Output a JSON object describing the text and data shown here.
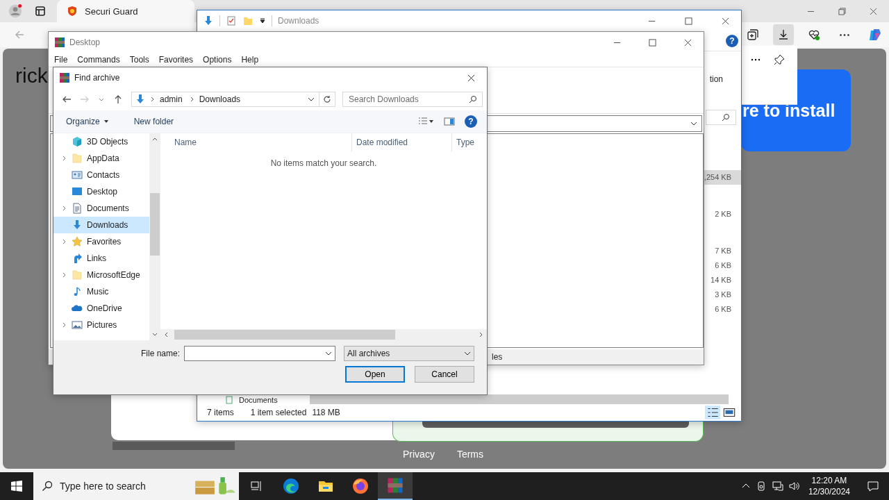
{
  "browser": {
    "tab_title": "Securi Guard",
    "toolbar_buttons": [
      {
        "selected": false
      },
      {
        "selected": true
      },
      {
        "selected": false
      },
      {
        "selected": false
      },
      {
        "selected": false
      }
    ],
    "page": {
      "heading": "rick",
      "banner": "re to install",
      "footer_links": [
        "Privacy",
        "Terms"
      ]
    }
  },
  "explorer": {
    "title": "Downloads",
    "ribbon_text": "tion",
    "sizes": [
      {
        "text": ",254 KB",
        "selected": true
      },
      {
        "text": "2 KB",
        "selected": false
      },
      {
        "text": "7 KB",
        "selected": false
      },
      {
        "text": "6 KB",
        "selected": false
      },
      {
        "text": "14 KB",
        "selected": false
      },
      {
        "text": "3 KB",
        "selected": false
      },
      {
        "text": "6 KB",
        "selected": false
      }
    ],
    "nav_item": "Documents",
    "help_icon": "?",
    "status": {
      "items": "7 items",
      "selection": "1 item selected",
      "size": "118 MB"
    }
  },
  "winrar": {
    "title": "Desktop",
    "menu": [
      "File",
      "Commands",
      "Tools",
      "Favorites",
      "Options",
      "Help"
    ],
    "status": "les"
  },
  "dialog": {
    "title": "Find archive",
    "path": [
      "admin",
      "Downloads"
    ],
    "search": {
      "placeholder": "Search Downloads"
    },
    "commands": [
      "Organize",
      "New folder"
    ],
    "help_icon": "?",
    "tree": [
      {
        "label": "3D Objects",
        "expandable": false,
        "selected": false
      },
      {
        "label": "AppData",
        "expandable": true,
        "selected": false
      },
      {
        "label": "Contacts",
        "expandable": false,
        "selected": false
      },
      {
        "label": "Desktop",
        "expandable": false,
        "selected": false
      },
      {
        "label": "Documents",
        "expandable": true,
        "selected": false
      },
      {
        "label": "Downloads",
        "expandable": false,
        "selected": true
      },
      {
        "label": "Favorites",
        "expandable": true,
        "selected": false
      },
      {
        "label": "Links",
        "expandable": false,
        "selected": false
      },
      {
        "label": "MicrosoftEdge",
        "expandable": true,
        "selected": false
      },
      {
        "label": "Music",
        "expandable": false,
        "selected": false
      },
      {
        "label": "OneDrive",
        "expandable": false,
        "selected": false
      },
      {
        "label": "Pictures",
        "expandable": true,
        "selected": false
      }
    ],
    "columns": [
      "Name",
      "Date modified",
      "Type"
    ],
    "empty_message": "No items match your search.",
    "file_name": {
      "label": "File name:"
    },
    "filter": "All archives",
    "buttons": [
      "Open",
      "Cancel"
    ]
  },
  "taskbar": {
    "search_placeholder": "Type here to search",
    "apps": [
      {
        "selected": false
      },
      {
        "selected": false
      },
      {
        "selected": false
      },
      {
        "selected": false
      },
      {
        "selected": true
      }
    ],
    "time": "12:20 AM",
    "date": "12/30/2024"
  }
}
